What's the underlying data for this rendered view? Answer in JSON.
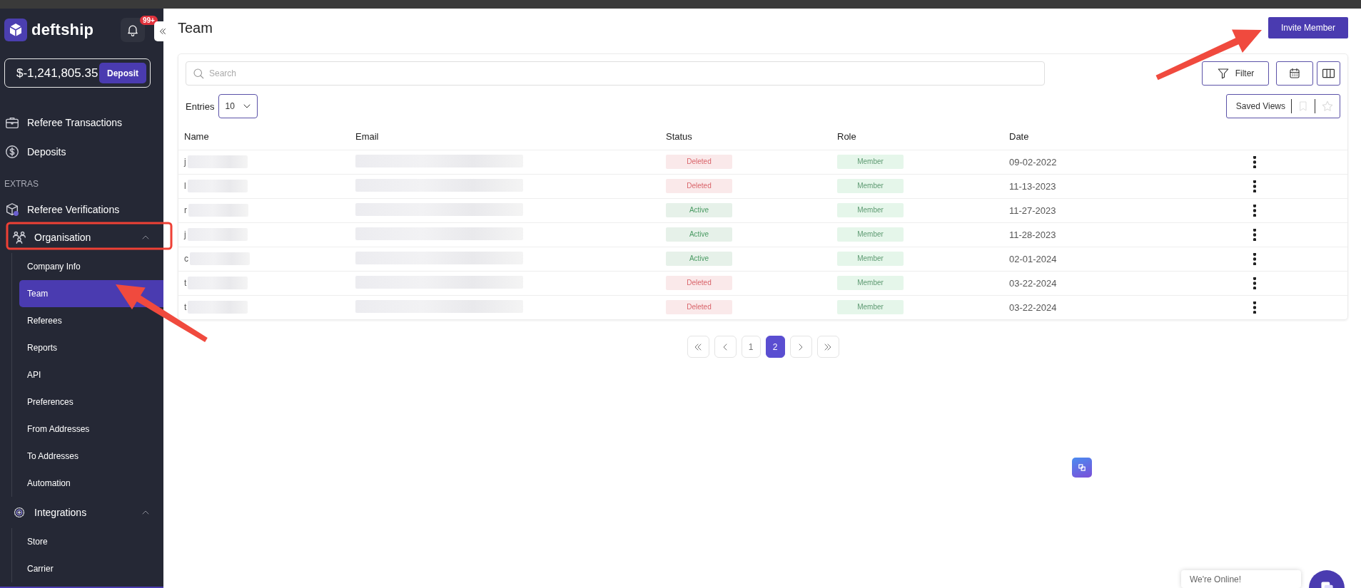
{
  "sidebar": {
    "logo": "deftship",
    "notification_badge": "99+",
    "balance": "$-1,241,805.35",
    "deposit_button": "Deposit",
    "items": [
      {
        "kind": "link",
        "label": "Referee Transactions"
      },
      {
        "kind": "link",
        "label": "Deposits"
      },
      {
        "kind": "section",
        "label": "EXTRAS"
      },
      {
        "kind": "link",
        "label": "Referee Verifications"
      },
      {
        "kind": "group",
        "label": "Organisation",
        "expanded": true,
        "children": [
          {
            "label": "Company Info",
            "selected": false
          },
          {
            "label": "Team",
            "selected": true
          },
          {
            "label": "Referees",
            "selected": false
          },
          {
            "label": "Reports",
            "selected": false
          },
          {
            "label": "API",
            "selected": false
          },
          {
            "label": "Preferences",
            "selected": false
          },
          {
            "label": "From Addresses",
            "selected": false
          },
          {
            "label": "To Addresses",
            "selected": false
          },
          {
            "label": "Automation",
            "selected": false
          }
        ]
      },
      {
        "kind": "group",
        "label": "Integrations",
        "expanded": true,
        "children": [
          {
            "label": "Store",
            "selected": false
          },
          {
            "label": "Carrier",
            "selected": false
          }
        ]
      }
    ]
  },
  "page": {
    "title": "Team",
    "invite_button": "Invite Member"
  },
  "toolbar": {
    "search": {
      "placeholder": "Search"
    },
    "filter_button": "Filter",
    "entries_label": "Entries",
    "entries_value": "10",
    "saved_views": "Saved Views"
  },
  "table": {
    "columns": [
      "Name",
      "Email",
      "Status",
      "Role",
      "Date"
    ],
    "rows": [
      {
        "name": "j",
        "redacted": true,
        "status": {
          "label": "Deleted",
          "color": "#d9646a"
        },
        "role": "Member",
        "date": "09-02-2022"
      },
      {
        "name": "l",
        "redacted": true,
        "status": {
          "label": "Deleted",
          "color": "#d9646a"
        },
        "role": "Member",
        "date": "11-13-2023"
      },
      {
        "name": "r",
        "redacted": true,
        "status": {
          "label": "Active",
          "color": "#4a9a63"
        },
        "role": "Member",
        "date": "11-27-2023"
      },
      {
        "name": "j",
        "redacted": true,
        "status": {
          "label": "Active",
          "color": "#4a9a63"
        },
        "role": "Member",
        "date": "11-28-2023"
      },
      {
        "name": "c",
        "redacted": true,
        "status": {
          "label": "Active",
          "color": "#4a9a63"
        },
        "role": "Member",
        "date": "02-01-2024"
      },
      {
        "name": "t",
        "redacted": true,
        "status": {
          "label": "Deleted",
          "color": "#d9646a"
        },
        "role": "Member",
        "date": "03-22-2024"
      },
      {
        "name": "t",
        "redacted": true,
        "status": {
          "label": "Deleted",
          "color": "#d9646a"
        },
        "role": "Member",
        "date": "03-22-2024"
      }
    ]
  },
  "pagination": {
    "pages": [
      {
        "label": "1",
        "selected": false
      },
      {
        "label": "2",
        "selected": true
      }
    ]
  },
  "chat_widget": {
    "message": "We're Online!"
  },
  "annotations": [
    {
      "kind": "box"
    },
    {
      "kind": "arrow"
    },
    {
      "kind": "arrow"
    }
  ]
}
